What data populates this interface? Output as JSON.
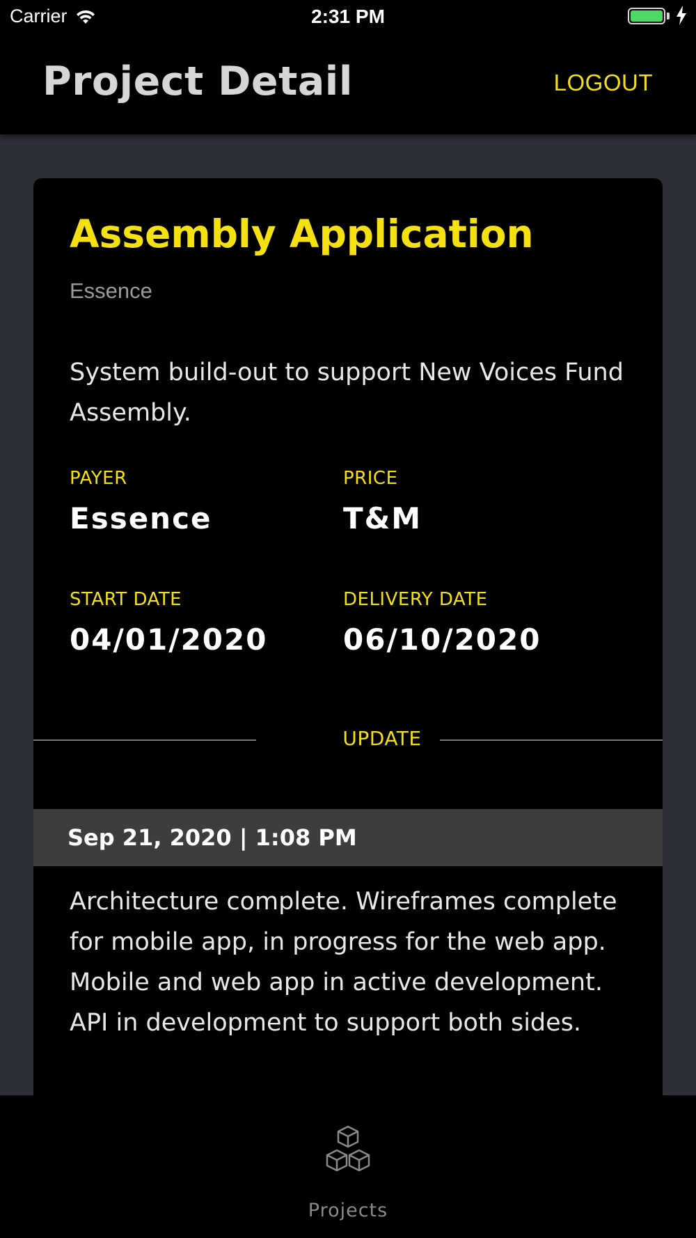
{
  "status": {
    "carrier": "Carrier",
    "time": "2:31 PM",
    "battery_color": "#4cd964"
  },
  "nav": {
    "title": "Project Detail",
    "logout_label": "LOGOUT"
  },
  "project": {
    "title": "Assembly Application",
    "client": "Essence",
    "description": "System build-out to support New Voices Fund Assembly.",
    "fields": {
      "payer_label": "PAYER",
      "payer_value": "Essence",
      "price_label": "PRICE",
      "price_value": "T&M",
      "start_label": "START DATE",
      "start_value": "04/01/2020",
      "delivery_label": "DELIVERY DATE",
      "delivery_value": "06/10/2020"
    },
    "update_label": "UPDATE"
  },
  "update_entry": {
    "timestamp": "Sep 21, 2020 | 1:08 PM",
    "text": "Architecture complete. Wireframes complete for mobile app, in progress for the web app. Mobile and web app in active development. API in development to support both sides."
  },
  "tabbar": {
    "items": [
      {
        "label": "Projects",
        "icon": "cubes-icon"
      }
    ]
  },
  "colors": {
    "accent": "#f5e012",
    "background": "#2e3038",
    "card": "#000000",
    "entry_header": "#3d3d3d"
  }
}
